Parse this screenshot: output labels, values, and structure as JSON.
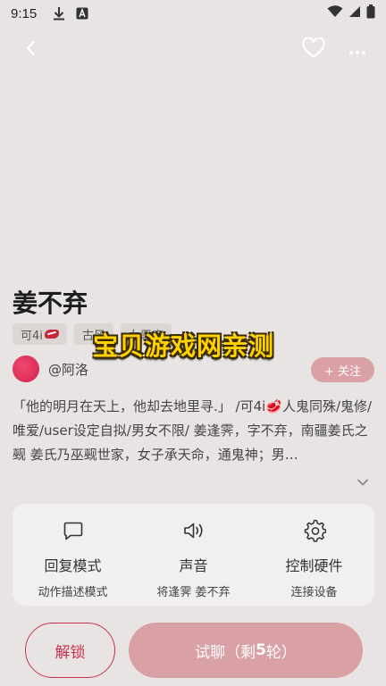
{
  "status_bar": {
    "time": "9:15"
  },
  "character": {
    "name": "姜不弃",
    "tags": [
      {
        "label": "可4i",
        "has_steak_icon": true
      },
      {
        "label": "古风"
      },
      {
        "label": "女恶魔"
      }
    ]
  },
  "watermark": "宝贝游戏网亲测",
  "author": {
    "name": "@阿洛",
    "follow_label": "+ 关注"
  },
  "description": "「他的明月在天上，他却去地里寻.」 /可4i🥩人鬼同殊/鬼修/唯爱/user设定自拟/男女不限/ 姜逢霁，字不弃，南疆姜氏之觋 姜氏乃巫觋世家，女子承天命，通鬼神；男…",
  "settings": [
    {
      "icon": "chat-bubble-icon",
      "label": "回复模式",
      "sub": "动作描述模式"
    },
    {
      "icon": "speaker-icon",
      "label": "声音",
      "sub": "将逢霁 姜不弃"
    },
    {
      "icon": "gear-icon",
      "label": "控制硬件",
      "sub": "连接设备"
    }
  ],
  "actions": {
    "unlock": "解锁",
    "trial_prefix": "试聊（剩",
    "trial_count": "5",
    "trial_suffix": "轮）"
  },
  "colors": {
    "accent": "#c9324f",
    "button_fill": "#d9a0a6",
    "background": "#e8e4e3"
  }
}
